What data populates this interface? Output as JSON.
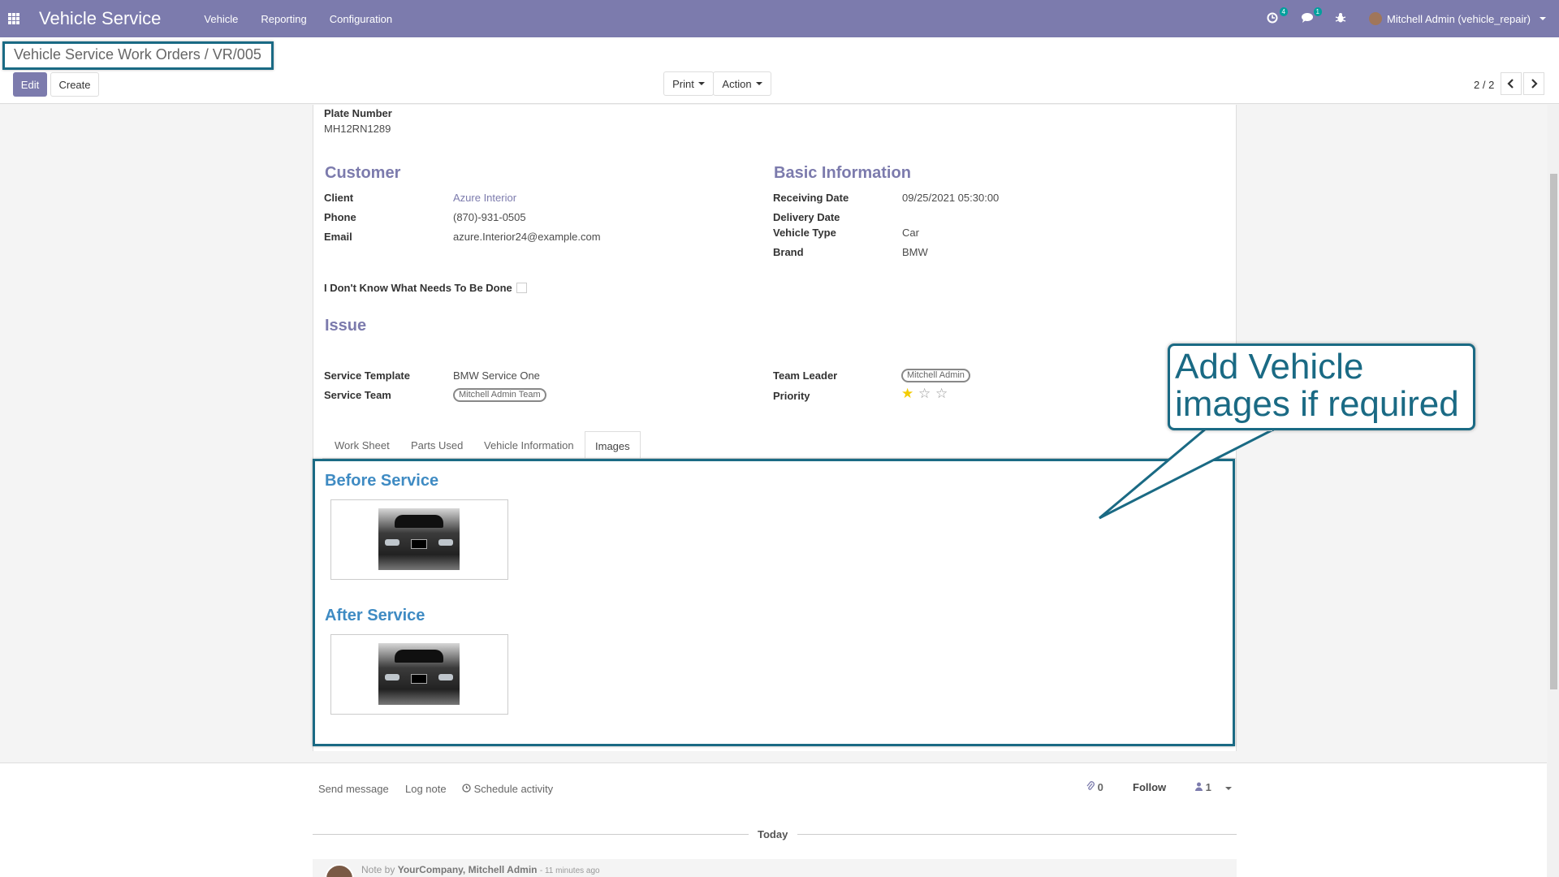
{
  "navbar": {
    "app_title": "Vehicle Service",
    "menu": [
      "Vehicle",
      "Reporting",
      "Configuration"
    ],
    "activity_count": "4",
    "messages_count": "1",
    "user": "Mitchell Admin (vehicle_repair)"
  },
  "control": {
    "breadcrumb_parent": "Vehicle Service Work Orders",
    "breadcrumb_sep": "/",
    "breadcrumb_current": "VR/005",
    "edit_label": "Edit",
    "create_label": "Create",
    "print_label": "Print",
    "action_label": "Action",
    "pager": "2 / 2"
  },
  "form": {
    "plate_label": "Plate Number",
    "plate_value": "MH12RN1289",
    "customer_title": "Customer",
    "client_label": "Client",
    "client_value": "Azure Interior",
    "phone_label": "Phone",
    "phone_value": "(870)-931-0505",
    "email_label": "Email",
    "email_value": "azure.Interior24@example.com",
    "basic_title": "Basic Information",
    "receiving_label": "Receiving Date",
    "receiving_value": "09/25/2021 05:30:00",
    "delivery_label": "Delivery Date",
    "vehicle_type_label": "Vehicle Type",
    "vehicle_type_value": "Car",
    "brand_label": "Brand",
    "brand_value": "BMW",
    "dont_know_label": "I Don't Know What Needs To Be Done",
    "issue_title": "Issue",
    "template_label": "Service Template",
    "template_value": "BMW Service One",
    "team_label": "Service Team",
    "team_value": "Mitchell Admin Team",
    "leader_label": "Team Leader",
    "leader_value": "Mitchell Admin",
    "priority_label": "Priority",
    "priority_stars": 1,
    "priority_max": 3
  },
  "tabs": [
    "Work Sheet",
    "Parts Used",
    "Vehicle Information",
    "Images"
  ],
  "images": {
    "before_title": "Before Service",
    "after_title": "After Service"
  },
  "callout": {
    "line1": "Add Vehicle",
    "line2": "images if required"
  },
  "chatter": {
    "send_message": "Send message",
    "log_note": "Log note",
    "schedule_activity": "Schedule activity",
    "attachments": "0",
    "follow": "Follow",
    "followers": "1",
    "today": "Today",
    "note_prefix": "Note by",
    "note_author": "YourCompany, Mitchell Admin",
    "note_time": "- 11 minutes ago"
  },
  "colors": {
    "navbar": "#7c7bad",
    "highlight": "#1a6a84",
    "image_title": "#3f8bc3",
    "star": "#f3cc00"
  }
}
